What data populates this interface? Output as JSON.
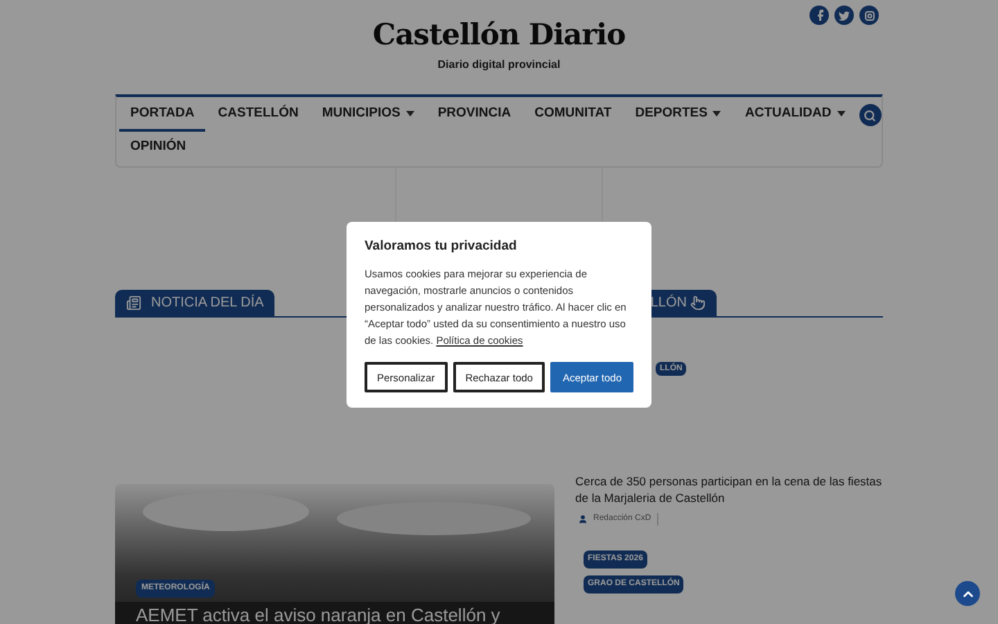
{
  "header": {
    "logo": "Castellón Diario",
    "tagline": "Diario digital provincial"
  },
  "nav": {
    "items": [
      {
        "label": "PORTADA",
        "selected": true,
        "dropdown": false
      },
      {
        "label": "CASTELLÓN",
        "selected": false,
        "dropdown": false
      },
      {
        "label": "MUNICIPIOS",
        "selected": false,
        "dropdown": true
      },
      {
        "label": "PROVINCIA",
        "selected": false,
        "dropdown": false
      },
      {
        "label": "COMUNITAT",
        "selected": false,
        "dropdown": false
      },
      {
        "label": "DEPORTES",
        "selected": false,
        "dropdown": true
      },
      {
        "label": "ACTUALIDAD",
        "selected": false,
        "dropdown": true
      },
      {
        "label": "OPINIÓN",
        "selected": false,
        "dropdown": false
      }
    ]
  },
  "sections": [
    {
      "title": "NOTICIA DEL DÍA"
    },
    {
      "title": "LLÓN"
    }
  ],
  "featured": {
    "category": "METEOROLOGÍA",
    "headline": "AEMET activa el aviso naranja en Castellón y"
  },
  "side": {
    "top_tag": "LLÓN",
    "headline": "Cerca de 350 personas participan en la cena de las fiestas de la Marjaleria de Castellón",
    "author": "Redacción CxD",
    "tags": [
      "FIESTAS 2026",
      "GRAO DE CASTELLÓN"
    ]
  },
  "cookie_dialog": {
    "title": "Valoramos tu privacidad",
    "body": "Usamos cookies para mejorar su experiencia de navegación, mostrarle anuncios o contenidos personalizados y analizar nuestro tráfico. Al hacer clic en “Aceptar todo” usted da su consentimiento a nuestro uso de las cookies.",
    "link": "Política de cookies",
    "buttons": [
      {
        "label": "Personalizar",
        "kind": "outline"
      },
      {
        "label": "Rechazar todo",
        "kind": "outline"
      },
      {
        "label": "Aceptar todo",
        "kind": "primary"
      }
    ]
  }
}
